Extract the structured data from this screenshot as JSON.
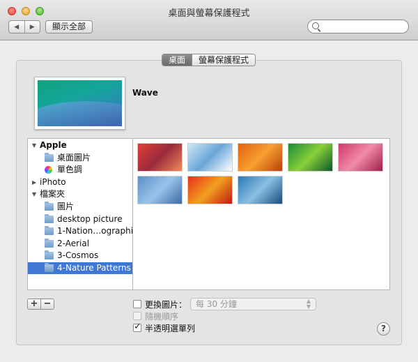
{
  "window": {
    "title": "桌面與螢幕保護程式"
  },
  "toolbar": {
    "back_label": "◀",
    "forward_label": "▶",
    "show_all_label": "顯示全部",
    "search_value": ""
  },
  "tabs": [
    {
      "label": "桌面",
      "active": true
    },
    {
      "label": "螢幕保護程式",
      "active": false
    }
  ],
  "current": {
    "name": "Wave"
  },
  "sources": [
    {
      "label": "Apple",
      "level": 0,
      "bold": true,
      "disclosure": "open",
      "icon": "none"
    },
    {
      "label": "桌面圖片",
      "level": 1,
      "icon": "folder-icon"
    },
    {
      "label": "單色調",
      "level": 1,
      "icon": "color-wheel-icon"
    },
    {
      "label": "iPhoto",
      "level": 0,
      "disclosure": "closed",
      "icon": "none"
    },
    {
      "label": "檔案夾",
      "level": 0,
      "disclosure": "open",
      "icon": "none"
    },
    {
      "label": "圖片",
      "level": 1,
      "icon": "pictures-folder-icon"
    },
    {
      "label": "desktop picture",
      "level": 1,
      "icon": "folder-icon"
    },
    {
      "label": "1-Nation…ographic",
      "level": 1,
      "icon": "folder-icon"
    },
    {
      "label": "2-Aerial",
      "level": 1,
      "icon": "folder-icon"
    },
    {
      "label": "3-Cosmos",
      "level": 1,
      "icon": "folder-icon"
    },
    {
      "label": "4-Nature Patterns",
      "level": 1,
      "icon": "folder-icon",
      "selected": true
    }
  ],
  "thumbnails": [
    {
      "name": "red-autumn-forest",
      "colors": [
        "#e0403a",
        "#9a2a3a",
        "#f08a5a"
      ]
    },
    {
      "name": "blue-ice-ripples",
      "colors": [
        "#cfe5f5",
        "#6aa7d8",
        "#ffffff"
      ]
    },
    {
      "name": "orange-bamboo",
      "colors": [
        "#e06010",
        "#f7a030",
        "#b84008"
      ]
    },
    {
      "name": "green-leaf",
      "colors": [
        "#1a8a3a",
        "#8ad03a",
        "#0a5a2a"
      ]
    },
    {
      "name": "pink-petals",
      "colors": [
        "#d03a6a",
        "#f08aa8",
        "#a0204a"
      ]
    },
    {
      "name": "blue-frost",
      "colors": [
        "#5a8fc8",
        "#9ac3e8",
        "#3a6aa8"
      ]
    },
    {
      "name": "red-leaf-veins",
      "colors": [
        "#e8301a",
        "#f0a020",
        "#c01a10"
      ]
    },
    {
      "name": "blue-birch-forest",
      "colors": [
        "#2a7ab8",
        "#8ac0e0",
        "#1a4a80"
      ]
    }
  ],
  "options": {
    "change_picture": {
      "label": "更換圖片：",
      "checked": false
    },
    "interval": {
      "value": "每 30 分鐘"
    },
    "random_order": {
      "label": "隨機順序",
      "checked": false,
      "disabled": true
    },
    "translucent_menu": {
      "label": "半透明選單列",
      "checked": true
    }
  },
  "buttons": {
    "add_label": "+",
    "remove_label": "−",
    "help_label": "?"
  },
  "colors": {
    "selection": "#3e77d4",
    "panel": "#e4e4e4"
  }
}
